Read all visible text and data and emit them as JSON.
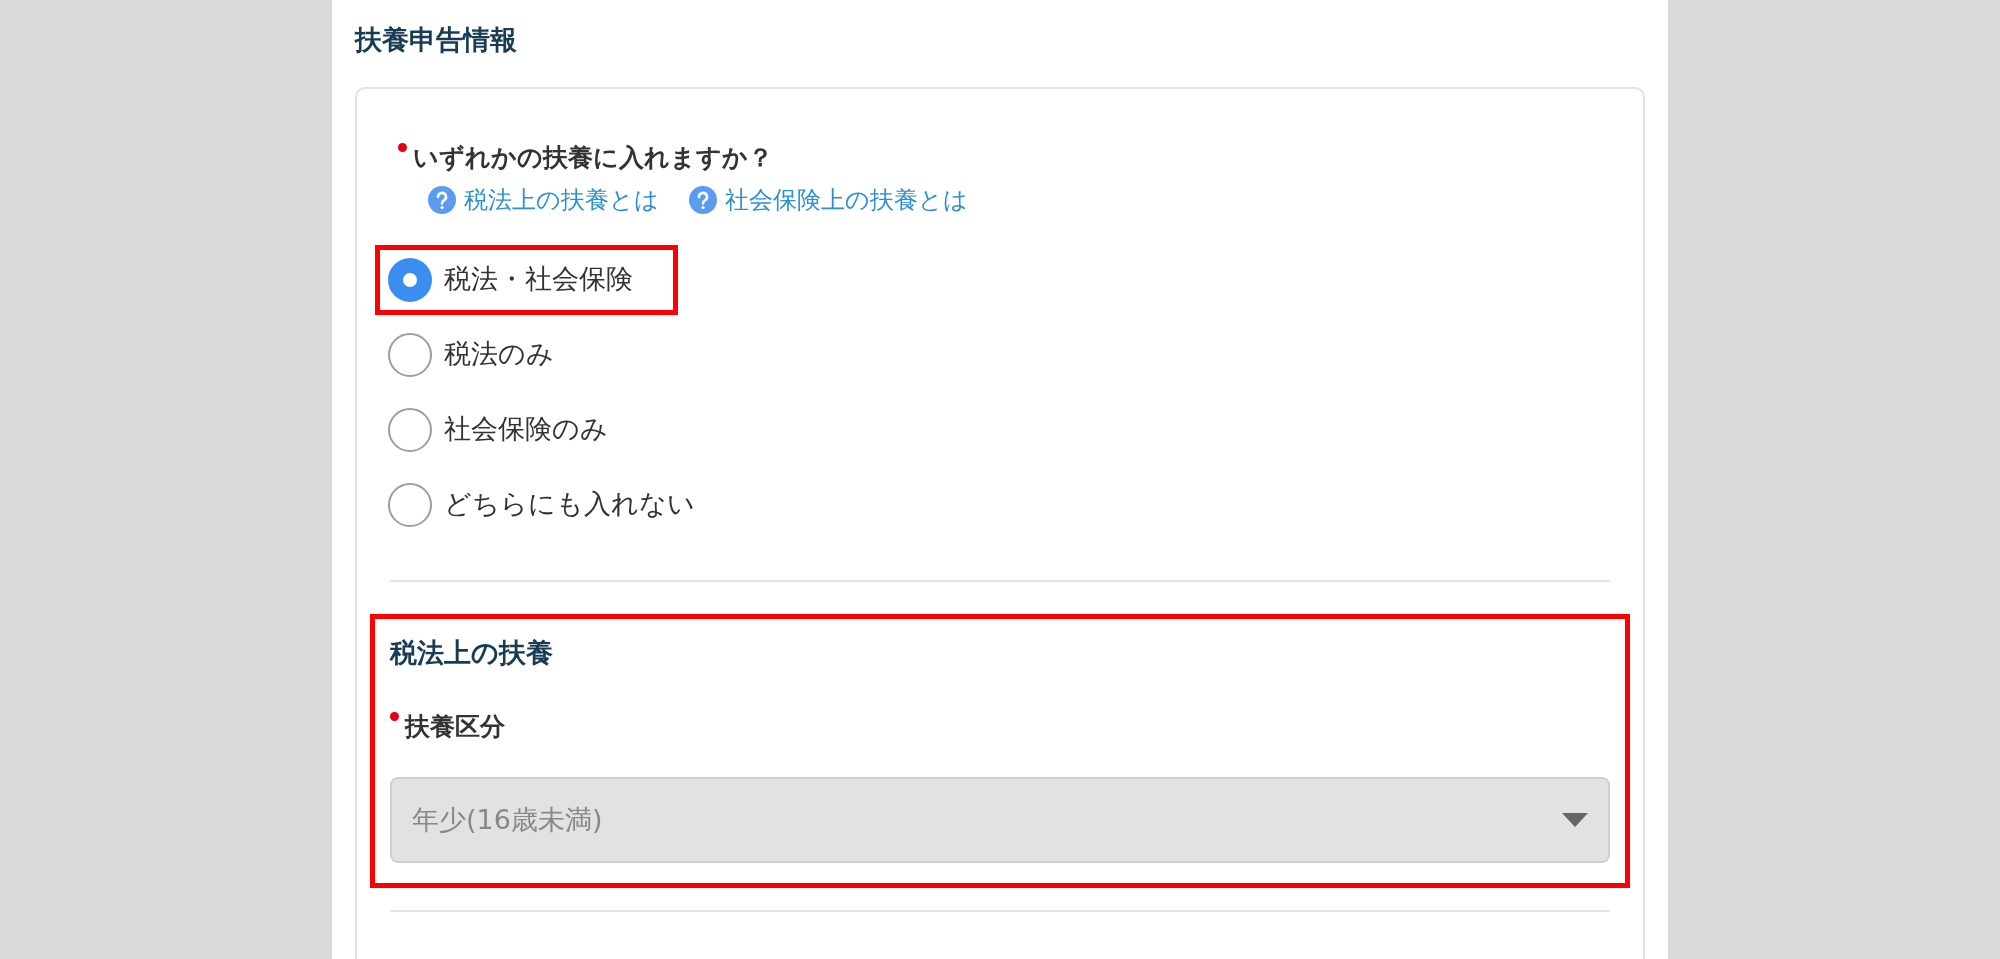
{
  "section_title": "扶養申告情報",
  "question": {
    "label": "いずれかの扶養に入れますか？",
    "required": true,
    "help_links": [
      {
        "label": "税法上の扶養とは"
      },
      {
        "label": "社会保険上の扶養とは"
      }
    ],
    "options": [
      {
        "label": "税法・社会保険",
        "selected": true,
        "highlighted": true
      },
      {
        "label": "税法のみ",
        "selected": false,
        "highlighted": false
      },
      {
        "label": "社会保険のみ",
        "selected": false,
        "highlighted": false
      },
      {
        "label": "どちらにも入れない",
        "selected": false,
        "highlighted": false
      }
    ]
  },
  "tax_section": {
    "title": "税法上の扶養",
    "highlighted": true,
    "field": {
      "label": "扶養区分",
      "required": true,
      "value": "年少(16歳未満)",
      "disabled": true
    }
  }
}
